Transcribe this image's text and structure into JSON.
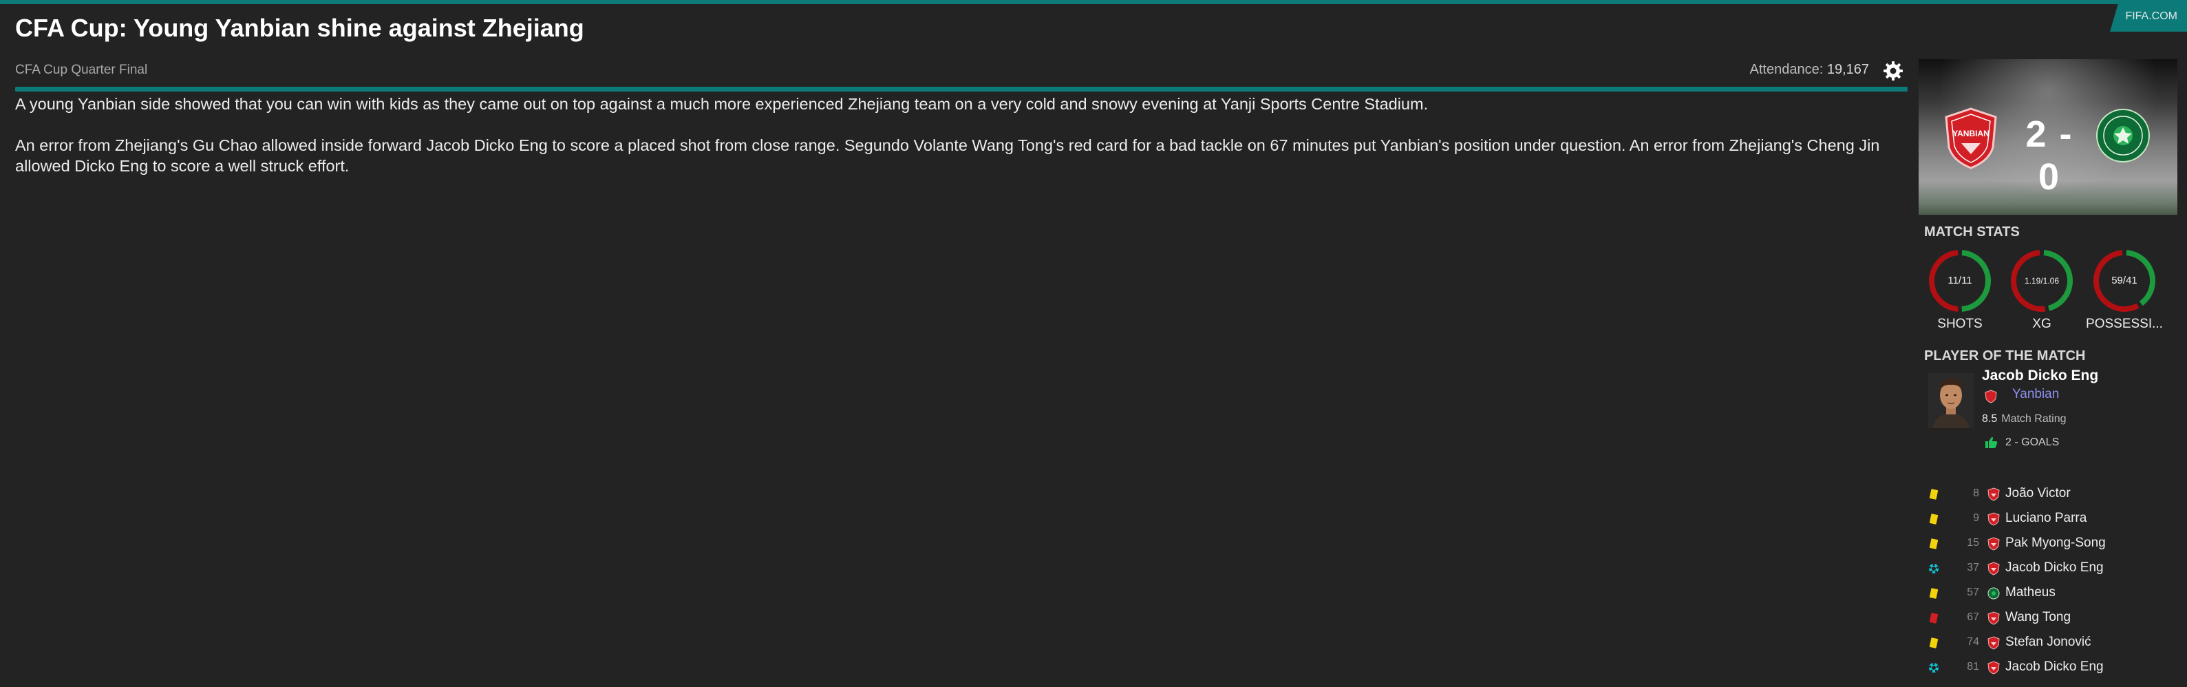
{
  "source": "FIFA.COM",
  "headline": "CFA Cup: Young Yanbian shine against Zhejiang",
  "competition": "CFA Cup Quarter Final",
  "attendance": {
    "label": "Attendance:",
    "value": "19,167"
  },
  "paragraphs": [
    "A young Yanbian side showed that you can win with kids as they came out on top against a much more experienced Zhejiang team on a very cold and snowy evening at Yanji Sports Centre Stadium.",
    "An error from Zhejiang's Gu Chao allowed inside forward Jacob Dicko Eng to score a placed shot from close range. Segundo Volante Wang Tong's red card for a bad tackle on 67 minutes put Yanbian's position under question. An error from Zhejiang's Cheng Jin allowed Dicko Eng to score a well struck effort."
  ],
  "score": "2 - 0",
  "home_crest_text": "YANBIAN",
  "match_stats": {
    "title": "MATCH STATS",
    "items": [
      {
        "label": "SHOTS",
        "value": "11/11",
        "home": 11,
        "away": 11
      },
      {
        "label": "XG",
        "value": "1.19/1.06",
        "home": 1.19,
        "away": 1.06
      },
      {
        "label": "POSSESSI...",
        "value": "59/41",
        "home": 59,
        "away": 41
      }
    ],
    "colors": {
      "home": "#b10f12",
      "away": "#1e9a3e"
    }
  },
  "potm": {
    "title": "PLAYER OF THE MATCH",
    "name": "Jacob Dicko Eng",
    "team": "Yanbian",
    "rating": "8.5",
    "rating_label": "Match Rating",
    "goals": "2 - GOALS"
  },
  "events": [
    {
      "type": "yellow-card",
      "minute": "8",
      "team": "home",
      "player": "João Victor"
    },
    {
      "type": "yellow-card",
      "minute": "9",
      "team": "home",
      "player": "Luciano Parra"
    },
    {
      "type": "yellow-card",
      "minute": "15",
      "team": "home",
      "player": "Pak Myong-Song"
    },
    {
      "type": "goal",
      "minute": "37",
      "team": "home",
      "player": "Jacob Dicko Eng"
    },
    {
      "type": "yellow-card",
      "minute": "57",
      "team": "away",
      "player": "Matheus"
    },
    {
      "type": "red-card",
      "minute": "67",
      "team": "home",
      "player": "Wang Tong"
    },
    {
      "type": "yellow-card",
      "minute": "74",
      "team": "home",
      "player": "Stefan Jonović"
    },
    {
      "type": "goal",
      "minute": "81",
      "team": "home",
      "player": "Jacob Dicko Eng"
    }
  ]
}
